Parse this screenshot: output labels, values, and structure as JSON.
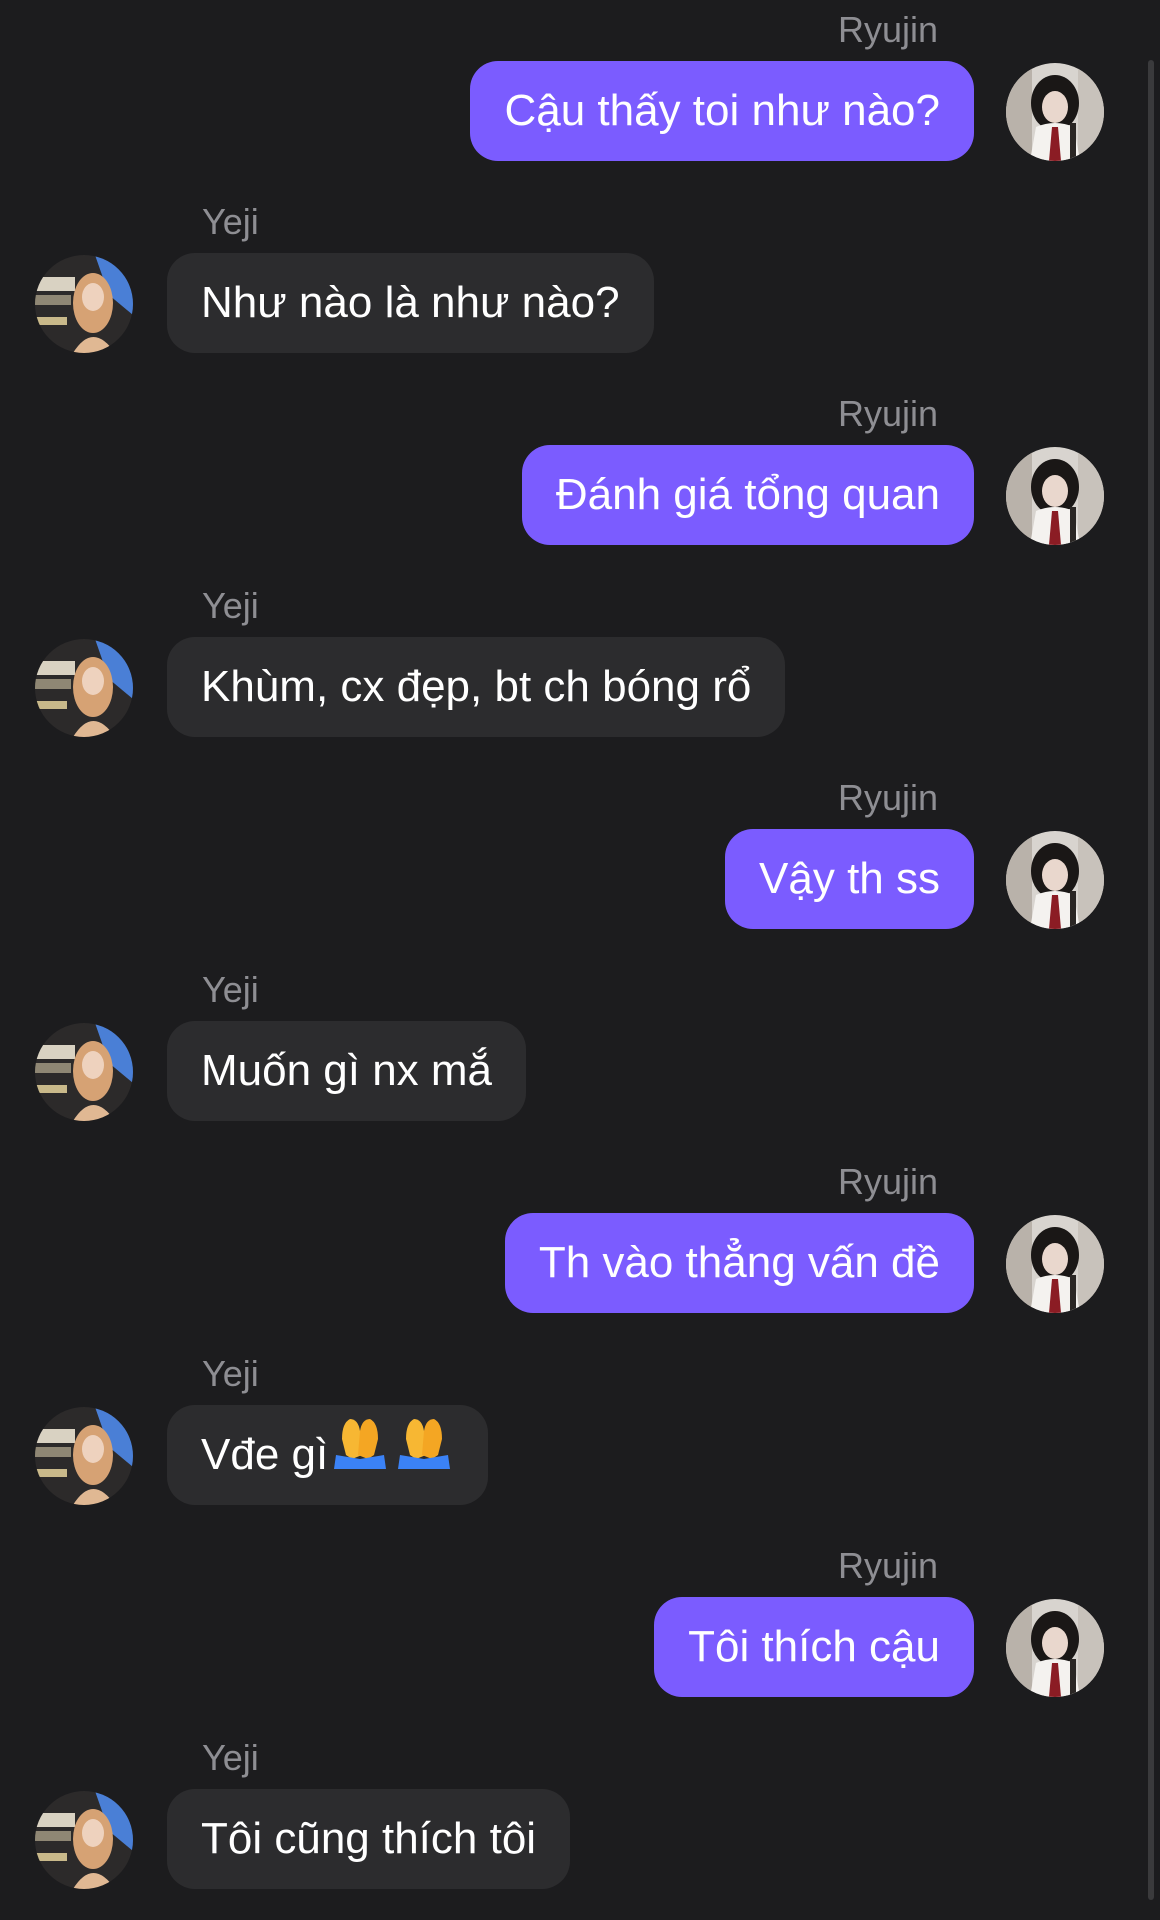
{
  "conversation": {
    "messages": [
      {
        "sender": "Ryujin",
        "text": "Cậu thấy toi như nào?",
        "direction": "outgoing"
      },
      {
        "sender": "Yeji",
        "text": "Như nào là như nào?",
        "direction": "incoming"
      },
      {
        "sender": "Ryujin",
        "text": "Đánh giá tổng quan",
        "direction": "outgoing"
      },
      {
        "sender": "Yeji",
        "text": "Khùm, cx đẹp, bt ch bóng rổ",
        "direction": "incoming"
      },
      {
        "sender": "Ryujin",
        "text": "Vậy th ss",
        "direction": "outgoing"
      },
      {
        "sender": "Yeji",
        "text": "Muốn gì nx mắ",
        "direction": "incoming"
      },
      {
        "sender": "Ryujin",
        "text": "Th vào thẳng vấn đề",
        "direction": "outgoing"
      },
      {
        "sender": "Yeji",
        "text": "Vđe gì",
        "emoji": "folded-hands-icon x2",
        "direction": "incoming"
      },
      {
        "sender": "Ryujin",
        "text": "Tôi thích cậu",
        "direction": "outgoing"
      },
      {
        "sender": "Yeji",
        "text": "Tôi cũng thích tôi",
        "direction": "incoming"
      }
    ]
  },
  "colors": {
    "background": "#1c1c1e",
    "outgoing_bubble": "#7b5cff",
    "incoming_bubble": "#2c2c2e",
    "sender_name": "#8e8e93",
    "message_text": "#ffffff"
  }
}
